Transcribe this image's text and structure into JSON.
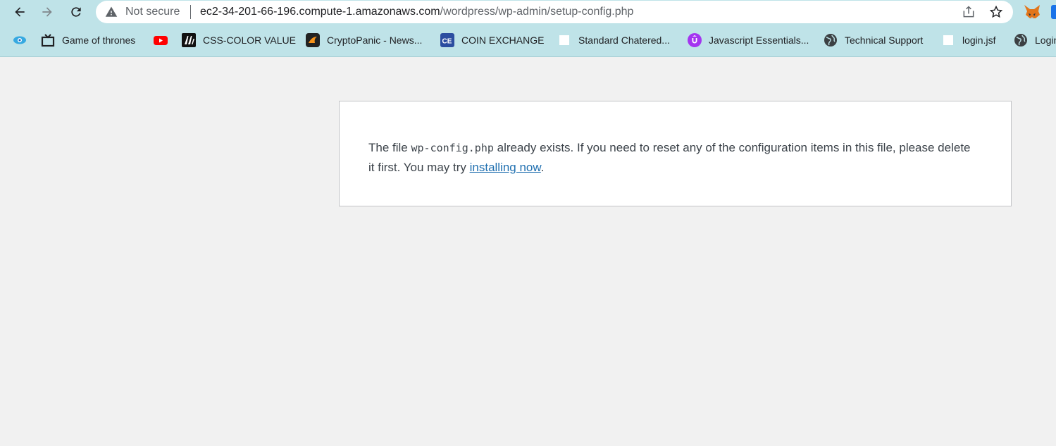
{
  "browser": {
    "not_secure": "Not secure",
    "url_host": "ec2-34-201-66-196.compute-1.amazonaws.com",
    "url_path": "/wordpress/wp-admin/setup-config.php"
  },
  "bookmarks": [
    {
      "label": "",
      "icon": "eye-icon"
    },
    {
      "label": "Game of thrones",
      "icon": "tv-icon"
    },
    {
      "label": "",
      "icon": "youtube-icon"
    },
    {
      "label": "CSS-COLOR VALUE",
      "icon": "m-logo-icon"
    },
    {
      "label": "CryptoPanic - News...",
      "icon": "cryptopanic-icon"
    },
    {
      "label": "COIN EXCHANGE",
      "icon": "ce-logo-icon"
    },
    {
      "label": "Standard Chatered...",
      "icon": "blank-page-icon"
    },
    {
      "label": "Javascript Essentials...",
      "icon": "udemy-icon"
    },
    {
      "label": "Technical Support",
      "icon": "globe-icon"
    },
    {
      "label": "login.jsf",
      "icon": "blank-page-icon"
    },
    {
      "label": "Login",
      "icon": "globe-icon"
    }
  ],
  "content": {
    "text_before": "The file ",
    "filename": "wp-config.php",
    "text_middle": " already exists. If you need to reset any of the configuration items in this file, please delete it first. You may try ",
    "link_label": "installing now",
    "text_after": "."
  },
  "colors": {
    "chrome": "#bfe3e8",
    "page_bg": "#f1f1f1",
    "link": "#2271b1"
  }
}
